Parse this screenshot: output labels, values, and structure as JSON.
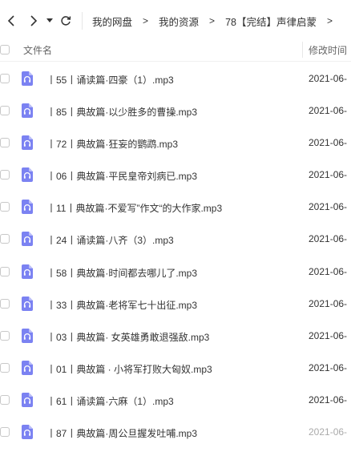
{
  "nav": {
    "back_icon": "chevron-left-icon",
    "forward_icon": "chevron-right-icon",
    "dropdown_icon": "caret-down-icon",
    "refresh_icon": "refresh-icon"
  },
  "breadcrumb": {
    "items": [
      "我的网盘",
      "我的资源",
      "78【完结】声律启蒙"
    ],
    "separator": ">"
  },
  "header": {
    "name_label": "文件名",
    "date_label": "修改时间"
  },
  "colors": {
    "icon_accent": "#7b82f2",
    "text": "#333333",
    "border": "#c8c8c8"
  },
  "files": [
    {
      "name": "丨55丨诵读篇·四豪（1）.mp3",
      "date": "2021-06-"
    },
    {
      "name": "丨85丨典故篇·以少胜多的曹操.mp3",
      "date": "2021-06-"
    },
    {
      "name": "丨72丨典故篇·狂妄的鹦鹉.mp3",
      "date": "2021-06-"
    },
    {
      "name": "丨06丨典故篇·平民皇帝刘病已.mp3",
      "date": "2021-06-"
    },
    {
      "name": "丨11丨典故篇·不爱写”作文“的大作家.mp3",
      "date": "2021-06-"
    },
    {
      "name": "丨24丨诵读篇·八齐（3）.mp3",
      "date": "2021-06-"
    },
    {
      "name": "丨58丨典故篇·时间都去哪儿了.mp3",
      "date": "2021-06-"
    },
    {
      "name": "丨33丨典故篇·老将军七十出征.mp3",
      "date": "2021-06-"
    },
    {
      "name": "丨03丨典故篇· 女英雄勇敢退强敌.mp3",
      "date": "2021-06-"
    },
    {
      "name": "丨01丨典故篇 · 小将军打败大匈奴.mp3",
      "date": "2021-06-"
    },
    {
      "name": "丨61丨诵读篇·六麻（1）.mp3",
      "date": "2021-06-"
    },
    {
      "name": "丨87丨典故篇·周公旦握发吐哺.mp3",
      "date": "2021-06-"
    }
  ]
}
